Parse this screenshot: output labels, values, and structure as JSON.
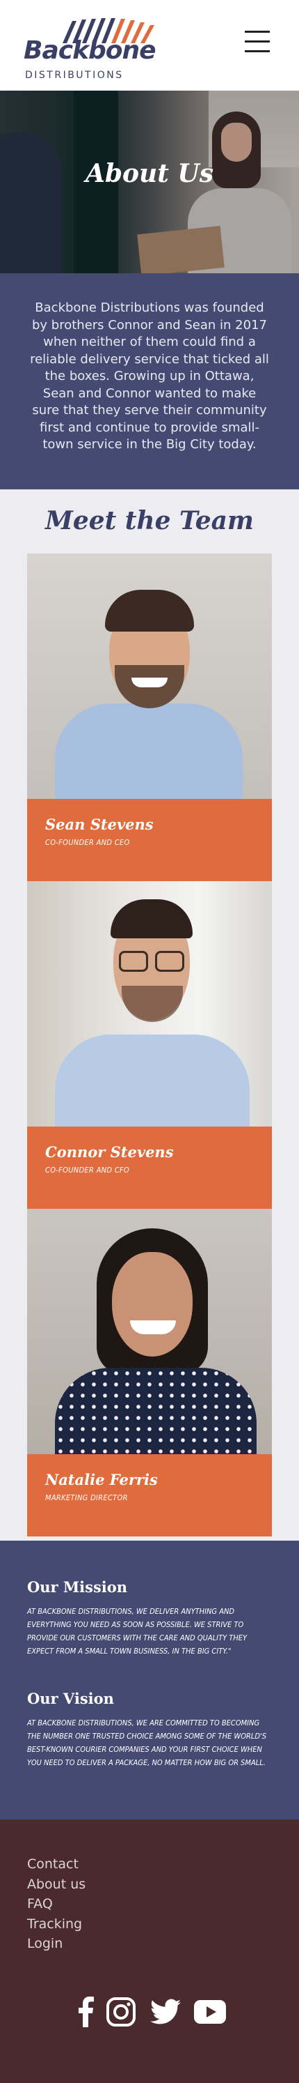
{
  "brand": {
    "name": "Backbone",
    "tagline": "DISTRIBUTIONS",
    "logo_color": "#3a3f66",
    "accent_color": "#e06c3e"
  },
  "header": {
    "menu_icon": "hamburger-menu-icon"
  },
  "hero": {
    "title": "About Us"
  },
  "about": {
    "text": "Backbone Distributions was founded by brothers Connor and Sean in 2017 when neither of them could find a reliable delivery service that ticked all the boxes. Growing up in Ottawa, Sean and Connor wanted to make sure that they serve their community first and continue to provide small-town service in the Big City today."
  },
  "team": {
    "title": "Meet the Team",
    "members": [
      {
        "name": "Sean Stevens",
        "role": "CO-FOUNDER AND CEO"
      },
      {
        "name": "Connor Stevens",
        "role": "CO-FOUNDER AND CFO"
      },
      {
        "name": "Natalie Ferris",
        "role": "MARKETING DIRECTOR"
      }
    ]
  },
  "mission": {
    "heading": "Our Mission",
    "text": "AT BACKBONE DISTRIBUTIONS, WE DELIVER ANYTHING AND EVERYTHING YOU NEED AS SOON AS POSSIBLE. WE STRIVE TO PROVIDE OUR CUSTOMERS WITH THE CARE AND QUALITY THEY EXPECT FROM A SMALL TOWN BUSINESS, IN THE BIG CITY.\""
  },
  "vision": {
    "heading": "Our Vision",
    "text": "AT BACKBONE DISTRIBUTIONS, WE ARE COMMITTED TO BECOMING THE NUMBER ONE TRUSTED CHOICE AMONG SOME OF THE WORLD'S BEST-KNOWN COURIER COMPANIES AND YOUR FIRST CHOICE WHEN YOU NEED TO DELIVER A PACKAGE, NO MATTER HOW BIG OR SMALL."
  },
  "footer": {
    "links": [
      "Contact",
      "About us",
      "FAQ",
      "Tracking",
      "Login"
    ],
    "social": [
      "facebook-icon",
      "instagram-icon",
      "twitter-icon",
      "youtube-icon"
    ]
  }
}
